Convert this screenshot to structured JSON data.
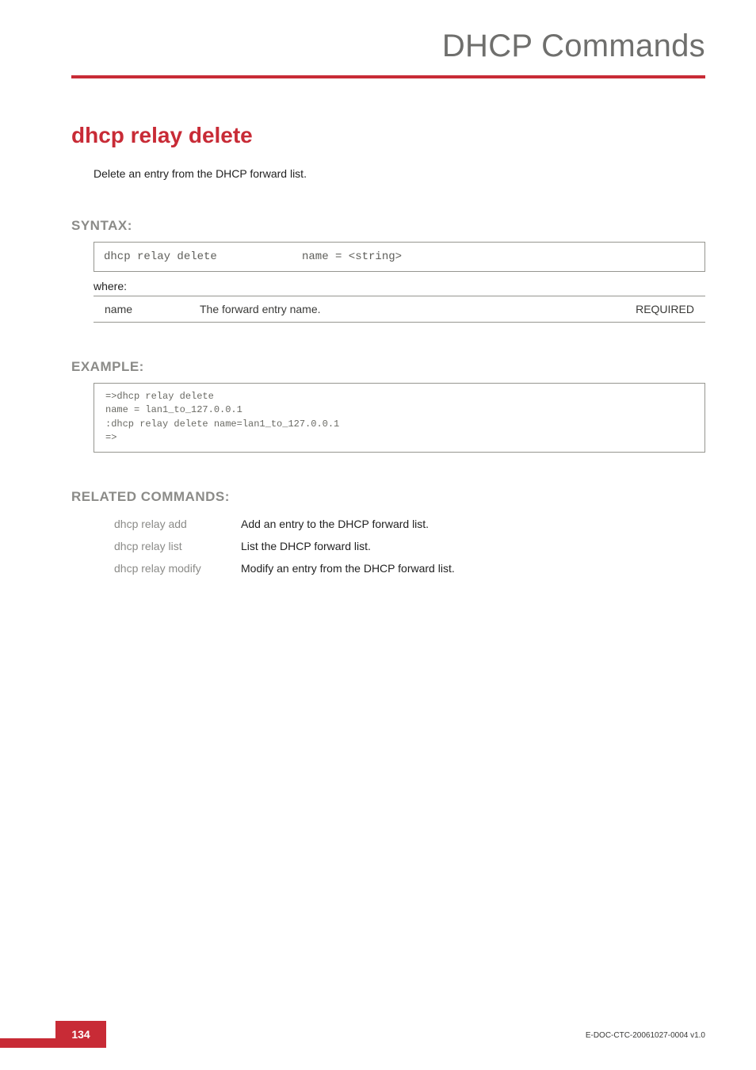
{
  "header": {
    "title": "DHCP Commands"
  },
  "command": {
    "name": "dhcp relay delete",
    "description": "Delete an entry from the DHCP forward list."
  },
  "syntax": {
    "heading": "SYNTAX:",
    "command": "dhcp relay delete",
    "args": "name = <string>",
    "where_label": "where:",
    "params": [
      {
        "name": "name",
        "desc": "The forward entry  name.",
        "req": "REQUIRED"
      }
    ]
  },
  "example": {
    "heading": "EXAMPLE:",
    "code": "=>dhcp relay delete\nname = lan1_to_127.0.0.1\n:dhcp relay delete name=lan1_to_127.0.0.1\n=>"
  },
  "related": {
    "heading": "RELATED COMMANDS:",
    "items": [
      {
        "cmd": "dhcp relay add",
        "desc": "Add an entry to the DHCP forward list."
      },
      {
        "cmd": "dhcp relay list",
        "desc": "List the DHCP forward list."
      },
      {
        "cmd": "dhcp relay modify",
        "desc": "Modify an entry from the DHCP forward list."
      }
    ]
  },
  "footer": {
    "page": "134",
    "docid": "E-DOC-CTC-20061027-0004 v1.0"
  }
}
